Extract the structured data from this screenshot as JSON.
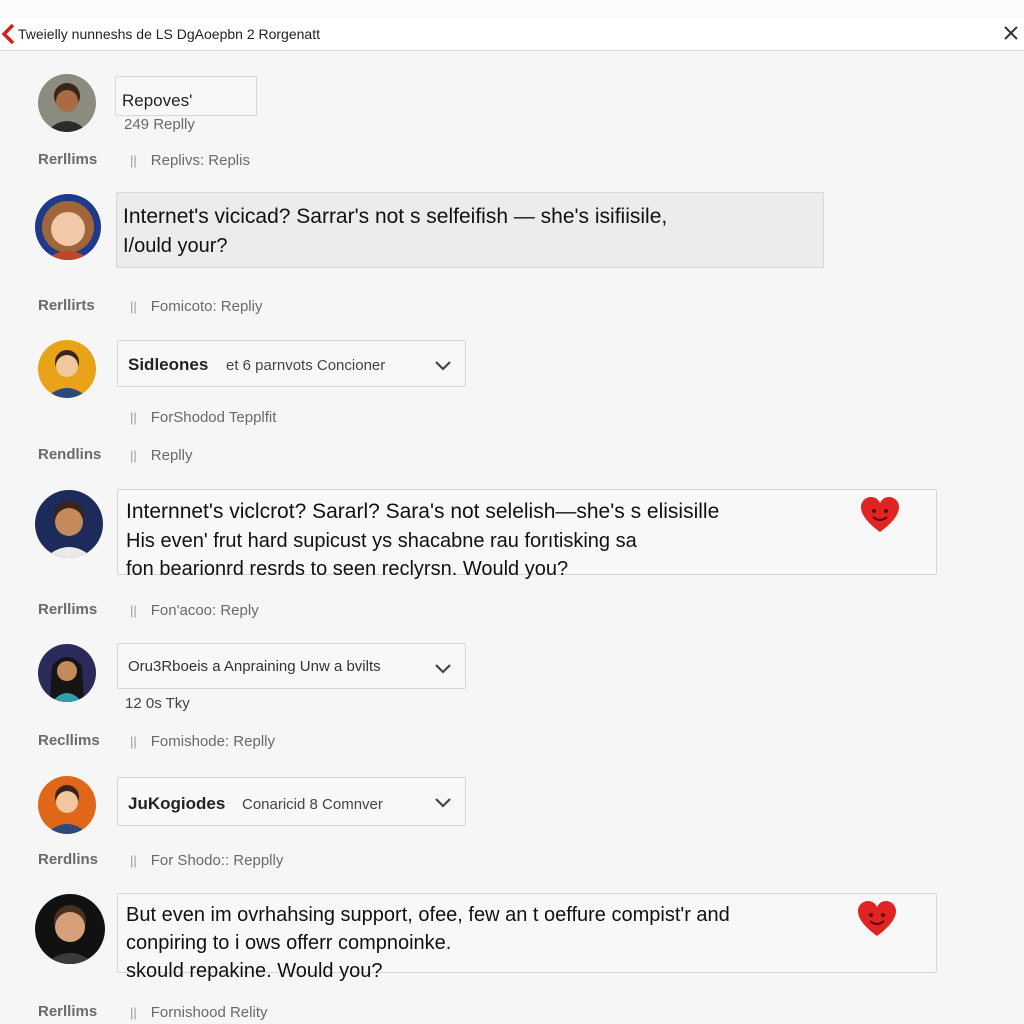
{
  "header": {
    "title": "Tweielly nunneshs de LS DgAoepbn 2 Rorgenatt"
  },
  "icons": {
    "back": "chevron-left-icon",
    "close": "close-icon",
    "expand": "chevron-down-icon",
    "reaction": "heart-face-icon"
  },
  "colors": {
    "accent": "#d81e1e",
    "heart": "#e02424",
    "card_border": "#d6d6d6"
  },
  "thread": {
    "c1": {
      "title": "Repoves'",
      "count": "249 Replly",
      "label": "Rerllims",
      "action": "Replivs:  Replis"
    },
    "c2": {
      "line1": "Internet's vicicad? Sarrar's not s selfeifish — she's isifiisile,",
      "line2": "I/ould your?",
      "label": "Rerllirts",
      "action": "Fomicoto:  Repliy"
    },
    "c3": {
      "title": "Sidleones",
      "subtitle": "et 6 parnvots Concioner",
      "sub_action": "ForShodod Tepplfit",
      "label": "Rendlins",
      "action": "Replly"
    },
    "c4": {
      "line1": "Internnet's viclcrot? Sararl? Sara's not selelish—she's s elisisille",
      "line2": "His even' frut hard  supicust ys shacabne rau  forıtisking sa",
      "line3": "fon bearionrd resrds to seen reclyrsn. Would you?",
      "label": "Rerllims",
      "action": "Fon'acoo:  Reply"
    },
    "c5": {
      "title": "Oru3Rboeis a Anpraining Unw a bvilts",
      "count": "12 0s Tky",
      "label": "Recllims",
      "action": "Fomishode:  Replly"
    },
    "c6": {
      "title": "JuKogiodes",
      "subtitle": "Conaricid 8 Comnver",
      "label": "Rerdlins",
      "action": "For Shodo::  Repplly"
    },
    "c7": {
      "line1": "But even im ovrhahsing support, ofee, few an t oeffure compist'r and",
      "line2": "conpiring to i ows offerr compnoinke.",
      "line3": "skould repakine. Would you?",
      "label": "Rerllims",
      "action": "Fornishood  Relity"
    }
  }
}
